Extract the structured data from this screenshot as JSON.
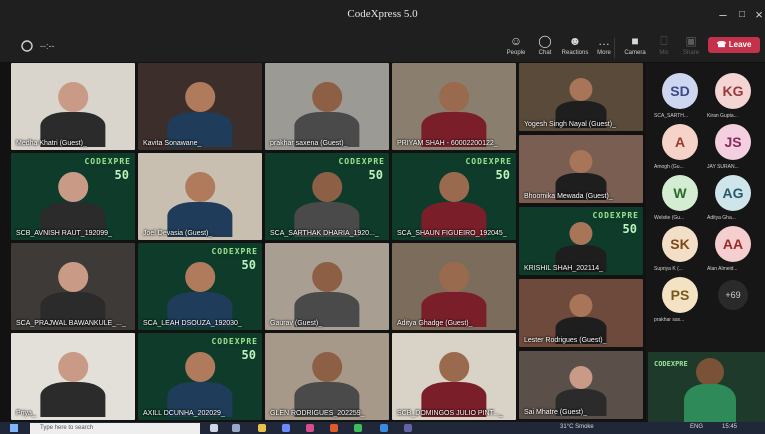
{
  "window": {
    "title": "CodeXpress 5.0"
  },
  "meeting": {
    "timer": "--:--",
    "toolbar": [
      {
        "label": "People",
        "icon": "people-icon",
        "glyph": "☺"
      },
      {
        "label": "Chat",
        "icon": "chat-icon",
        "glyph": "◯"
      },
      {
        "label": "Reactions",
        "icon": "reactions-icon",
        "glyph": "☻"
      },
      {
        "label": "More",
        "icon": "more-icon",
        "glyph": "…"
      },
      {
        "label": "Camera",
        "icon": "camera-icon",
        "glyph": "■"
      },
      {
        "label": "Mic",
        "icon": "mic-icon",
        "glyph": "⎕"
      },
      {
        "label": "Share",
        "icon": "share-icon",
        "glyph": "▣"
      }
    ],
    "leave_label": "Leave"
  },
  "tiles": [
    {
      "name": "Medha Khatri (Guest) ̲"
    },
    {
      "name": "Kavita Sonawane ̲"
    },
    {
      "name": "prakhar saxena (Guest) ̲"
    },
    {
      "name": "PRIYAM SHAH - 60002200122 ̲"
    },
    {
      "name": "Yogesh Singh Nayal (Guest) ̲"
    },
    {
      "name": "SCB_AVNISH RAUT_192099 ̲"
    },
    {
      "name": "Joel Devasia (Guest) ̲"
    },
    {
      "name": "SCA_SARTHAK DHARIA_1920... ̲"
    },
    {
      "name": "SCA_SHAUN FIGUEIRO_192045 ̲"
    },
    {
      "name": "Bhoomika Mewada (Guest) ̲"
    },
    {
      "name": "SCA_PRAJWAL BAWANKULE_... ̲"
    },
    {
      "name": "SCA_LEAH DSOUZA_192030 ̲"
    },
    {
      "name": "Gaurav (Guest) ̲"
    },
    {
      "name": "Aditya Ghadge (Guest) ̲"
    },
    {
      "name": "KRISHIL SHAH_202114 ̲"
    },
    {
      "name": "Priya ̲"
    },
    {
      "name": "AXILL DCUNHA_202029 ̲"
    },
    {
      "name": "GLEN RODRIGUES_202259 ̲"
    },
    {
      "name": "SCB_DOMINGOS JULIO PINT... ̲"
    },
    {
      "name": "Lester Rodrigues (Guest) ̲"
    },
    {
      "name": "Sai Mhatre (Guest) ̲"
    }
  ],
  "banner": {
    "brand": "CODEXPRE",
    "version": "50"
  },
  "roster": [
    {
      "initials": "SD",
      "name": "SCA_SARTH...",
      "bg": "#cfd6f0",
      "fg": "#3a4a8a"
    },
    {
      "initials": "KG",
      "name": "Kiran Gupta...",
      "bg": "#f5d4d4",
      "fg": "#9a3a3a"
    },
    {
      "initials": "A",
      "name": "Amogh (Gu...",
      "bg": "#f6d3c8",
      "fg": "#9a3a2a"
    },
    {
      "initials": "JS",
      "name": "JAY SURAN...",
      "bg": "#f3cfe0",
      "fg": "#8a2a5a"
    },
    {
      "initials": "W",
      "name": "Welstie (Gu...",
      "bg": "#d3ecd2",
      "fg": "#2a6a2a"
    },
    {
      "initials": "AG",
      "name": "Aditya Gha...",
      "bg": "#cfe5ec",
      "fg": "#2a5a6a"
    },
    {
      "initials": "SK",
      "name": "Supriya K (...",
      "bg": "#f3dfc7",
      "fg": "#7a4a1a"
    },
    {
      "initials": "AA",
      "name": "Alan Almeid...",
      "bg": "#f5cfcf",
      "fg": "#9a2a2a"
    },
    {
      "initials": "PS",
      "name": "prakhar sax...",
      "bg": "#f4e2c4",
      "fg": "#7a5a1a"
    }
  ],
  "more_participants": "+69",
  "taskbar": {
    "search_placeholder": "Type here to search",
    "weather": "31°C Smoke",
    "lang": "ENG",
    "time": "15:45"
  },
  "colors": {
    "leave": "#c4314b",
    "accent": "#6264a7"
  }
}
